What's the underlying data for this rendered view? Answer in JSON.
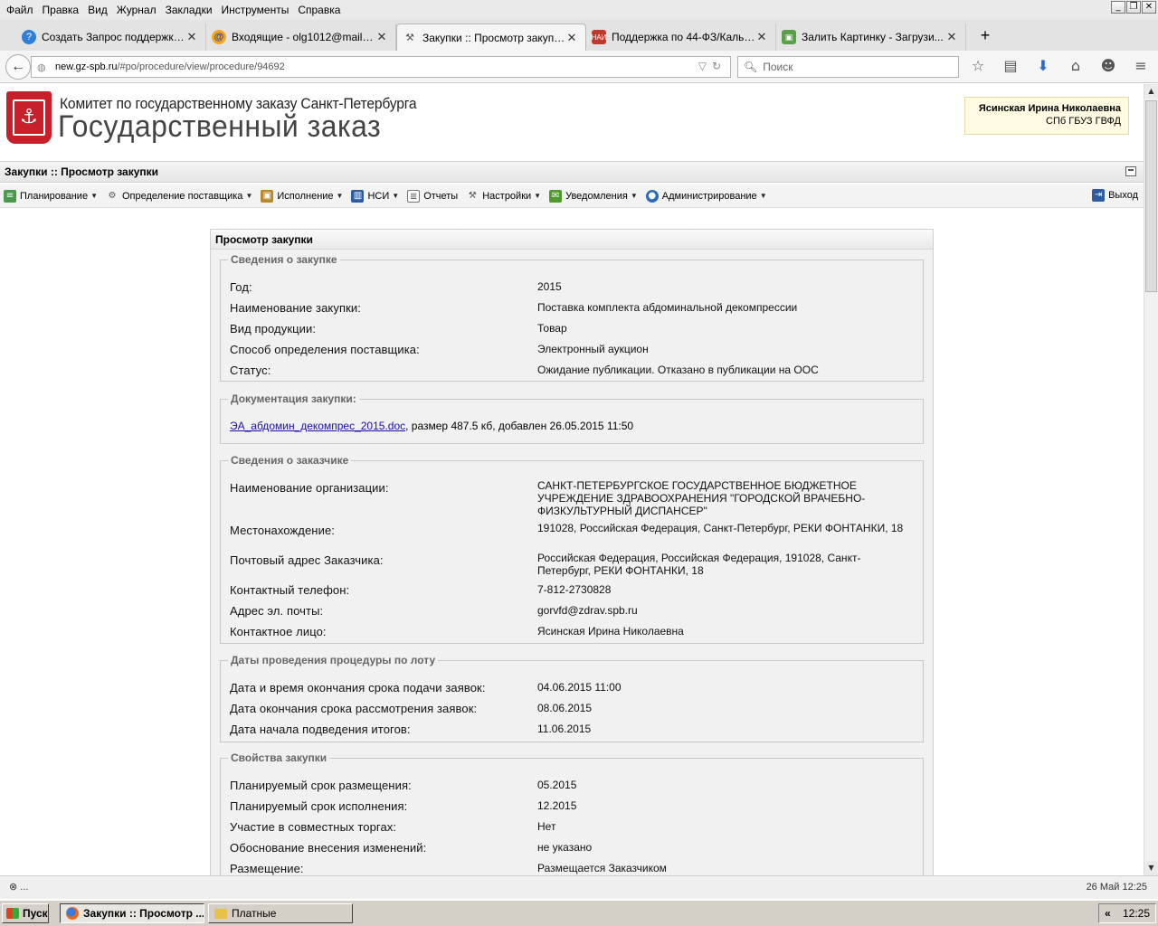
{
  "browser": {
    "menu": [
      "Файл",
      "Правка",
      "Вид",
      "Журнал",
      "Закладки",
      "Инструменты",
      "Справка"
    ],
    "tabs": [
      {
        "title": "Создать Запрос поддержки...",
        "icon": "help-icon",
        "active": false
      },
      {
        "title": "Входящие - olg1012@mail.ru...",
        "icon": "mail-icon",
        "active": false
      },
      {
        "title": "Закупки :: Просмотр закупк...",
        "icon": "tools-icon",
        "active": true
      },
      {
        "title": "Поддержка по 44-ФЗ/Кальк...",
        "icon": "nai-icon",
        "active": false
      },
      {
        "title": "Залить Картинку - Загрузи...",
        "icon": "image-icon",
        "active": false
      }
    ],
    "url_host": "new.gz-spb.ru",
    "url_path": "/#po/procedure/view/procedure/94692",
    "search_placeholder": "Поиск"
  },
  "site": {
    "committee": "Комитет по государственному заказу Санкт-Петербурга",
    "title": "Государственный заказ",
    "user_name": "Ясинская Ирина Николаевна",
    "user_org": "СПб ГБУЗ ГВФД",
    "breadcrumb": "Закупки :: Просмотр закупки",
    "menu": [
      "Планирование",
      "Определение поставщика",
      "Исполнение",
      "НСИ",
      "Отчеты",
      "Настройки",
      "Уведомления",
      "Администрирование"
    ],
    "exit": "Выход"
  },
  "panel": {
    "title": "Просмотр закупки",
    "purchase": {
      "legend": "Сведения о закупке",
      "rows": [
        {
          "label": "Год:",
          "value": "2015"
        },
        {
          "label": "Наименование закупки:",
          "value": "Поставка комплекта абдоминальной декомпрессии"
        },
        {
          "label": "Вид продукции:",
          "value": "Товар"
        },
        {
          "label": "Способ определения поставщика:",
          "value": "Электронный аукцион"
        },
        {
          "label": "Статус:",
          "value": "Ожидание публикации. Отказано в публикации на ООС"
        }
      ]
    },
    "docs": {
      "legend": "Документация закупки:",
      "file": "ЭА_абдомин_декомпрес_2015.doc",
      "info": ", размер 487.5 кб, добавлен 26.05.2015 11:50"
    },
    "customer": {
      "legend": "Сведения о заказчике",
      "rows": [
        {
          "label": "Наименование организации:",
          "value": "САНКТ-ПЕТЕРБУРГСКОЕ ГОСУДАРСТВЕННОЕ БЮДЖЕТНОЕ УЧРЕЖДЕНИЕ ЗДРАВООХРАНЕНИЯ \"ГОРОДСКОЙ ВРАЧЕБНО-ФИЗКУЛЬТУРНЫЙ ДИСПАНСЕР\""
        },
        {
          "label": "Местонахождение:",
          "value": "191028, Российская Федерация, Санкт-Петербург, РЕКИ ФОНТАНКИ, 18"
        },
        {
          "label": "Почтовый адрес Заказчика:",
          "value": "Российская Федерация, Российская Федерация, 191028, Санкт-Петербург, РЕКИ ФОНТАНКИ, 18"
        },
        {
          "label": "Контактный телефон:",
          "value": "7-812-2730828"
        },
        {
          "label": "Адрес эл. почты:",
          "value": "gorvfd@zdrav.spb.ru"
        },
        {
          "label": "Контактное лицо:",
          "value": "Ясинская Ирина Николаевна"
        }
      ]
    },
    "dates": {
      "legend": "Даты проведения процедуры по лоту",
      "rows": [
        {
          "label": "Дата и время окончания срока подачи заявок:",
          "value": "04.06.2015 11:00"
        },
        {
          "label": "Дата окончания срока рассмотрения заявок:",
          "value": "08.06.2015"
        },
        {
          "label": "Дата начала подведения итогов:",
          "value": "11.06.2015"
        }
      ]
    },
    "props": {
      "legend": "Свойства закупки",
      "rows": [
        {
          "label": "Планируемый срок размещения:",
          "value": "05.2015"
        },
        {
          "label": "Планируемый срок исполнения:",
          "value": "12.2015"
        },
        {
          "label": "Участие в совместных торгах:",
          "value": "Нет"
        },
        {
          "label": "Обоснование внесения изменений:",
          "value": "не указано"
        },
        {
          "label": "Размещение:",
          "value": "Размещается Заказчиком"
        }
      ]
    }
  },
  "statusbar": {
    "left": "⊗ ...",
    "right": "26 Май 12:25"
  },
  "taskbar": {
    "start": "Пуск",
    "tasks": [
      "Закупки :: Просмотр ...",
      "Платные"
    ],
    "clock": "12:25"
  }
}
